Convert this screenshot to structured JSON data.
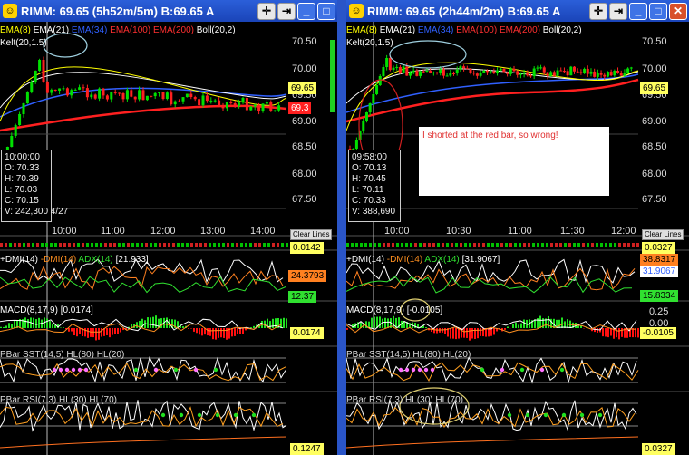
{
  "left": {
    "title": "RIMM:  69.65 (5h52m/5m)   B:69.65 A",
    "indicators": [
      "EMA(8)",
      "EMA(21)",
      "EMA(34)",
      "EMA(100)",
      "EMA(200)",
      "Boll(20,2)"
    ],
    "kelt": "Kelt(20,1.5)",
    "y_ticks": [
      "70.50",
      "70.00",
      "69.50",
      "69.00",
      "68.50",
      "68.00",
      "67.50"
    ],
    "price_tags": [
      "69.65",
      "69.3"
    ],
    "x_ticks": [
      "10:00",
      "11:00",
      "12:00",
      "13:00",
      "14:00"
    ],
    "clear_lines": "Clear Lines",
    "info": [
      "10:00:00",
      "O: 70.33",
      "H: 70.39",
      "L: 70.03",
      "C: 70.15",
      "V: 242,300  4/27"
    ],
    "top_value": "0.0142",
    "dmi_label": "+DMI(14)",
    "dmi_minus": "-DMI(14)",
    "adx_label": "ADX(14)",
    "dmi_value": "[21.933]",
    "dmi_tags": [
      "24.3793",
      "12.37"
    ],
    "macd_label": "MACD(8,17,9)",
    "macd_value": "[0.0174]",
    "macd_tag": "0.0174",
    "sst_labels": [
      "PBar",
      "SST(14,5)",
      "HL(80)",
      "HL(20)"
    ],
    "rsi_labels": [
      "PBar",
      "RSI(7,3)",
      "HL(30)",
      "HL(70)"
    ],
    "bottom_tag": "0.1247"
  },
  "right": {
    "title": "RIMM:  69.65 (2h44m/2m)   B:69.65 A",
    "indicators": [
      "EMA(8)",
      "EMA(21)",
      "EMA(34)",
      "EMA(100)",
      "EMA(200)",
      "Boll(20,2)"
    ],
    "kelt": "Kelt(20,1.5)",
    "y_ticks": [
      "70.50",
      "70.00",
      "69.50",
      "69.00",
      "68.50",
      "68.00",
      "67.50"
    ],
    "price_tags": [
      "69.65"
    ],
    "x_ticks": [
      "10:00",
      "10:30",
      "11:00",
      "11:30",
      "12:00"
    ],
    "clear_lines": "Clear Lines",
    "info": [
      "09:58:00",
      "O: 70.13",
      "H: 70.45",
      "L: 70.11",
      "C: 70.33",
      "V: 388,690"
    ],
    "note": "I shorted at the red bar, so wrong!",
    "top_value": "0.0327",
    "dmi_label": "+DMI(14)",
    "dmi_minus": "-DMI(14)",
    "adx_label": "ADX(14)",
    "dmi_value": "[31.9067]",
    "dmi_tags": [
      "38.8317",
      "31.9067",
      "15.8334"
    ],
    "macd_label": "MACD(8,17,9)",
    "macd_value": "[-0.0105]",
    "macd_ticks": [
      "0.25",
      "0.00"
    ],
    "macd_tag": "-0.0105",
    "sst_labels": [
      "PBar",
      "SST(14,5)",
      "HL(80)",
      "HL(20)"
    ],
    "rsi_labels": [
      "PBar",
      "RSI(7,3)",
      "HL(30)",
      "HL(70)"
    ],
    "bottom_tag": "0.0327"
  },
  "colors": {
    "ema8": "#ffff00",
    "ema21": "#ffffff",
    "ema34": "#3060ff",
    "ema100": "#ff2020",
    "ema200": "#ff2020",
    "boll": "#ffffff",
    "up": "#00e000",
    "down": "#ff2020",
    "ellipse": "#9fd0e0",
    "titlebar": "#1f4fc8"
  },
  "icons": [
    "rimm-app-icon",
    "crosshair-icon",
    "pin-icon",
    "minimize-icon",
    "maximize-icon",
    "close-icon"
  ]
}
